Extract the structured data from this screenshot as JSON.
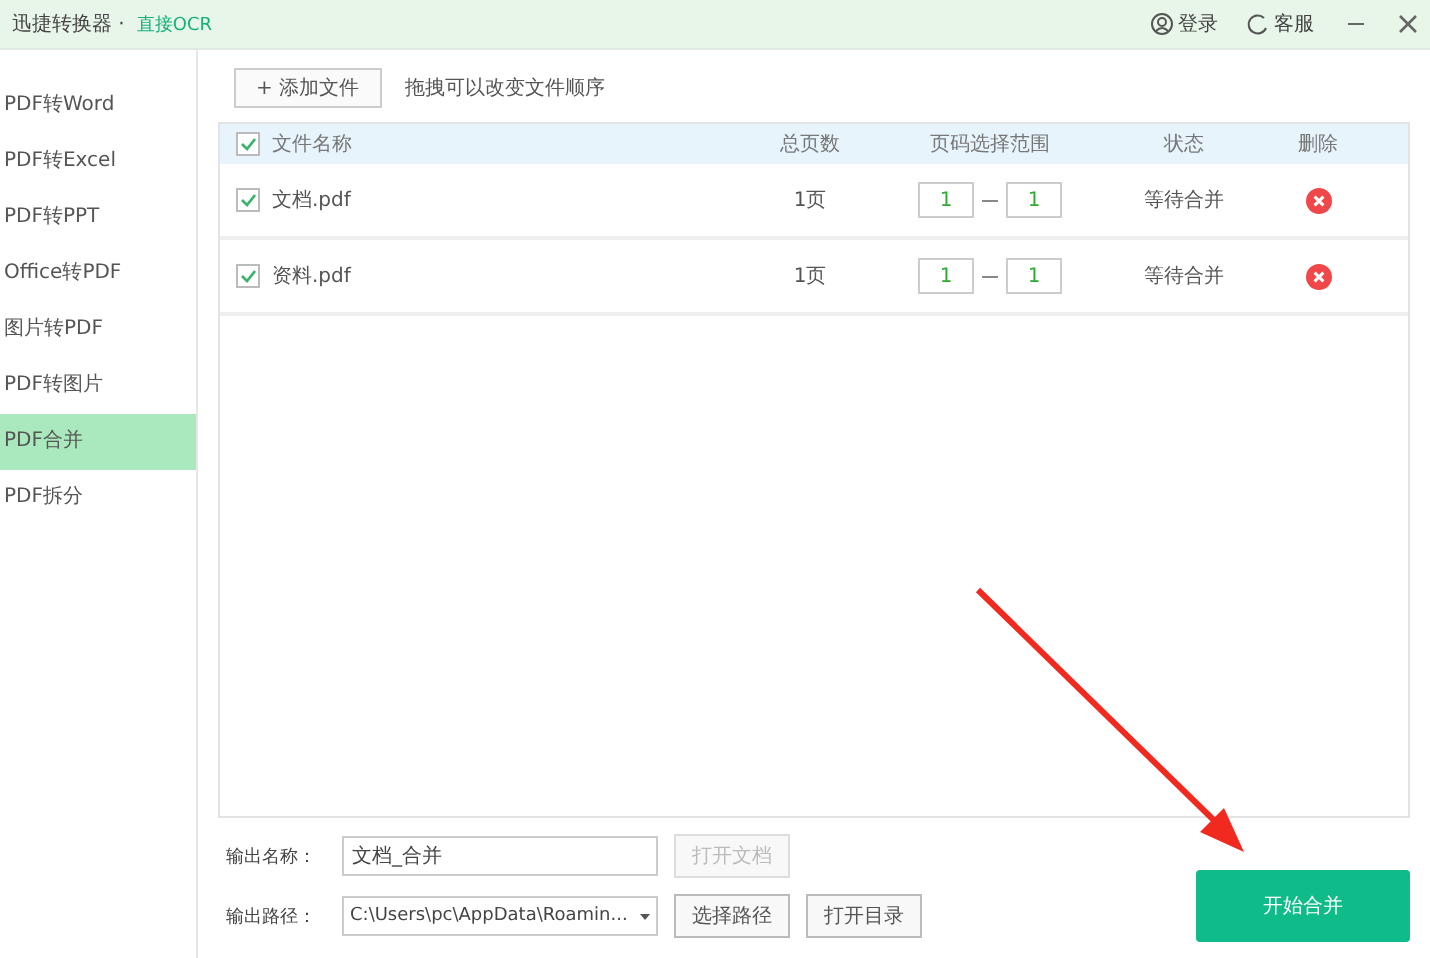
{
  "window": {
    "title": "迅捷转换器 ·",
    "tag": "直接OCR",
    "actions": [
      {
        "kind": "login",
        "label": "登录"
      },
      {
        "kind": "service",
        "label": "客服"
      }
    ]
  },
  "sidebar": {
    "items": [
      {
        "label": "PDF转Word",
        "selected": false
      },
      {
        "label": "PDF转Excel",
        "selected": false
      },
      {
        "label": "PDF转PPT",
        "selected": false
      },
      {
        "label": "Office转PDF",
        "selected": false
      },
      {
        "label": "图片转PDF",
        "selected": false
      },
      {
        "label": "PDF转图片",
        "selected": false
      },
      {
        "label": "PDF合并",
        "selected": true
      },
      {
        "label": "PDF拆分",
        "selected": false
      }
    ]
  },
  "toolbar": {
    "add_button": "+ 添加文件",
    "hint": "拖拽可以改变文件顺序"
  },
  "table": {
    "all_checked": true,
    "columns": [
      "文件名称",
      "总页数",
      "页码选择范围",
      "状态",
      "删除"
    ],
    "rows": [
      {
        "checked": true,
        "name": "文档.pdf",
        "pages": "1页",
        "from": "1",
        "to": "1",
        "status": "等待合并"
      },
      {
        "checked": true,
        "name": "资料.pdf",
        "pages": "1页",
        "from": "1",
        "to": "1",
        "status": "等待合并"
      }
    ]
  },
  "output": {
    "name_label": "输出名称：",
    "name_value": "文档_合并",
    "open_doc": "打开文档",
    "path_label": "输出路径：",
    "path_value": "C:\\Users\\pc\\AppData\\Roamin...",
    "choose_path": "选择路径",
    "open_dir": "打开目录",
    "start": "开始合并"
  }
}
